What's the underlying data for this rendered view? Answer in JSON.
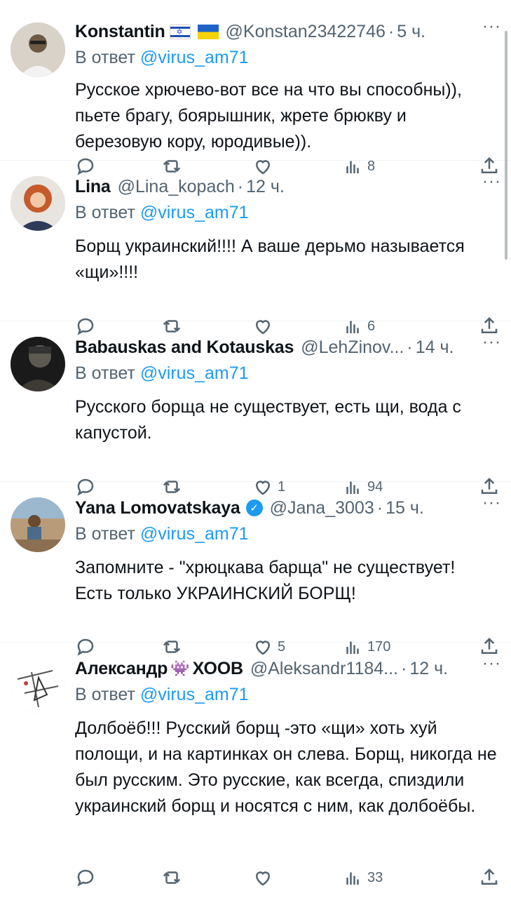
{
  "tweets": [
    {
      "name": "Konstantin",
      "flags": [
        "israel-flag",
        "ukraine-flag"
      ],
      "verified": false,
      "handle": "@Konstan23422746",
      "time": "5 ч.",
      "reply_prefix": "В ответ",
      "reply_to": "@virus_am71",
      "text": "Русское хрючево-вот все на что вы способны)), пьете брагу, боярышник, жрете брюкву и березовую кору, юродивые)).",
      "likes": "",
      "views": "8",
      "avatar_colors": [
        "#d8d2c8",
        "#6e5a44"
      ]
    },
    {
      "name": "Lina",
      "verified": false,
      "handle": "@Lina_kopach",
      "time": "12 ч.",
      "reply_prefix": "В ответ",
      "reply_to": "@virus_am71",
      "text": "Борщ украинский!!!! А ваше дерьмо называется «щи»!!!!",
      "likes": "",
      "views": "6",
      "avatar_colors": [
        "#c65a2a",
        "#2e3b57"
      ]
    },
    {
      "name": "Babauskas and Kotauskas",
      "verified": false,
      "handle": "@LehZinov...",
      "time": "14 ч.",
      "reply_prefix": "В ответ",
      "reply_to": "@virus_am71",
      "text": "Русского борща не существует, есть щи, вода с капустой.",
      "likes": "1",
      "views": "94",
      "avatar_colors": [
        "#1a1a1a",
        "#5c5a50"
      ]
    },
    {
      "name": "Yana Lomovatskaya",
      "verified": true,
      "handle": "@Jana_3003",
      "time": "15 ч.",
      "reply_prefix": "В ответ",
      "reply_to": "@virus_am71",
      "text": "Запомните - \"хрюцкава барща\" не существует! Есть только УКРАИНСКИЙ БОРЩ!",
      "likes": "5",
      "views": "170",
      "avatar_colors": [
        "#b89c7a",
        "#4a6b8a"
      ]
    },
    {
      "name_part1": "Александр",
      "name_part2": "ХООВ",
      "verified": false,
      "handle": "@Aleksandr1184...",
      "time": "12 ч.",
      "reply_prefix": "В ответ",
      "reply_to": "@virus_am71",
      "text": "Долбоёб!!! Русский борщ -это «щи» хоть хуй полощи, и на картинках он слева. Борщ, никогда не был русским. Это русские, как всегда, спиздили украинский борщ и носятся с ним, как долбоёбы.",
      "likes": "",
      "views": "33",
      "avatar_colors": [
        "#ffffff",
        "#555555"
      ]
    }
  ],
  "icons": {
    "reply": "reply-icon",
    "retweet": "retweet-icon",
    "like": "like-icon",
    "views": "views-icon",
    "share": "share-icon",
    "more": "more-icon",
    "alien": "alien-monster-icon",
    "verified": "verified-badge-icon"
  },
  "colors": {
    "mention": "#1d9bf0",
    "secondary_text": "#536471",
    "primary_text": "#0f1419",
    "verified": "#1d9bf0"
  }
}
